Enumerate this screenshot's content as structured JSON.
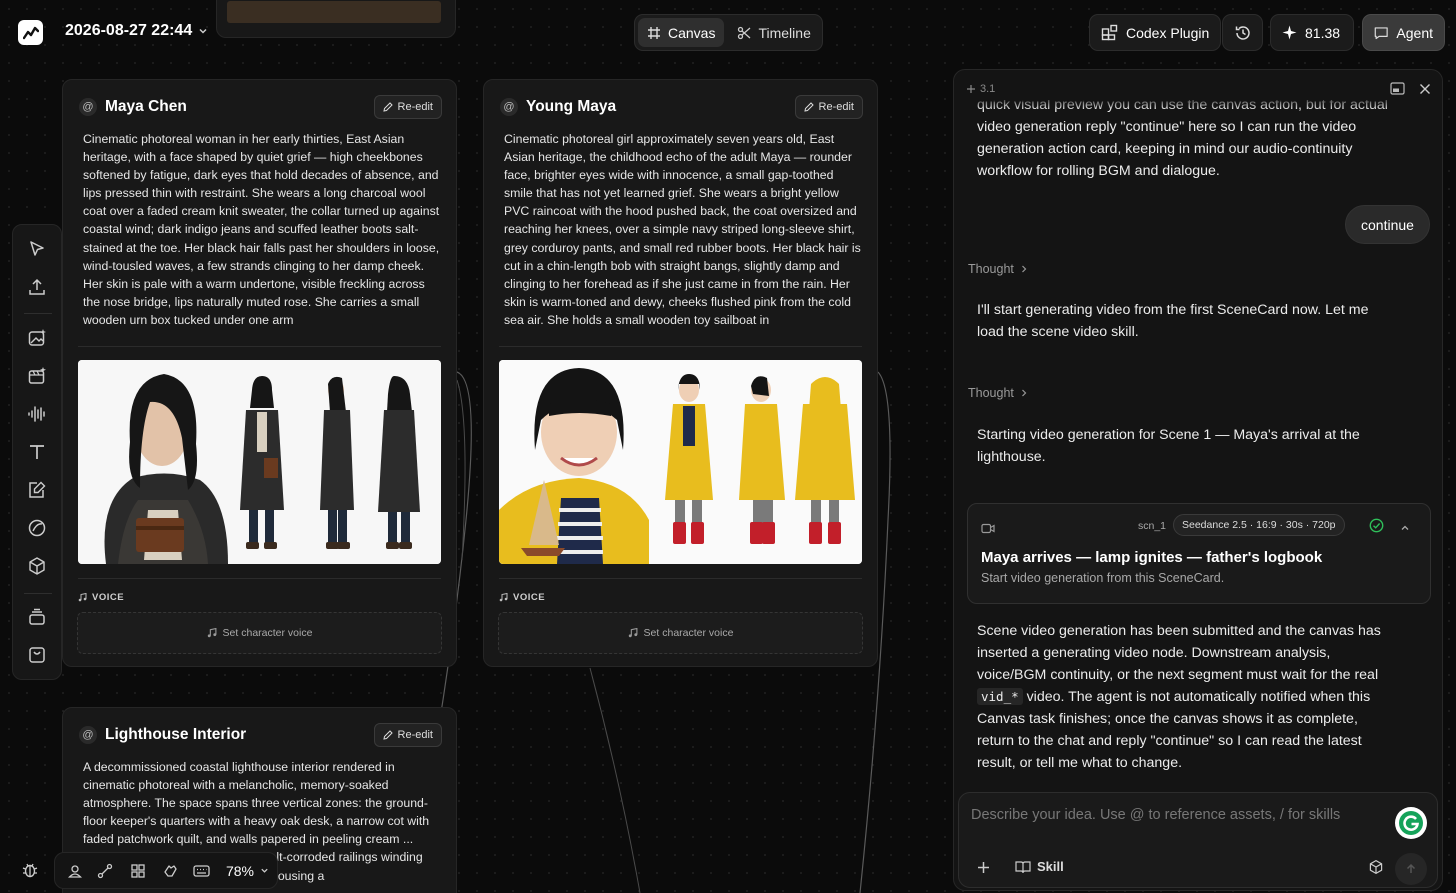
{
  "header": {
    "datetime": "2026-08-27 22:44",
    "tabs": [
      {
        "label": "Canvas",
        "active": true
      },
      {
        "label": "Timeline",
        "active": false
      }
    ],
    "codex_label": "Codex Plugin",
    "credits": "81.38",
    "agent_label": "Agent"
  },
  "cards": [
    {
      "title": "Maya Chen",
      "reedit_label": "Re-edit",
      "description": "Cinematic photoreal woman in her early thirties, East Asian heritage, with a face shaped by quiet grief — high cheekbones softened by fatigue, dark eyes that hold decades of absence, and lips pressed thin with restraint. She wears a long charcoal wool coat over a faded cream knit sweater, the collar turned up against coastal wind; dark indigo jeans and scuffed leather boots salt-stained at the toe. Her black hair falls past her shoulders in loose, wind-tousled waves, a few strands clinging to her damp cheek. Her skin is pale with a warm undertone, visible freckling across the nose bridge, lips naturally muted rose. She carries a small wooden urn box tucked under one arm",
      "voice_label": "VOICE",
      "voice_button": "Set character voice"
    },
    {
      "title": "Young Maya",
      "reedit_label": "Re-edit",
      "description": "Cinematic photoreal girl approximately seven years old, East Asian heritage, the childhood echo of the adult Maya — rounder face, brighter eyes wide with innocence, a small gap-toothed smile that has not yet learned grief. She wears a bright yellow PVC raincoat with the hood pushed back, the coat oversized and reaching her knees, over a simple navy striped long-sleeve shirt, grey corduroy pants, and small red rubber boots. Her black hair is cut in a chin-length bob with straight bangs, slightly damp and clinging to her forehead as if she just came in from the rain. Her skin is warm-toned and dewy, cheeks flushed pink from the cold sea air. She holds a small wooden toy sailboat in",
      "voice_label": "VOICE",
      "voice_button": "Set character voice"
    },
    {
      "title": "Lighthouse Interior",
      "reedit_label": "Re-edit",
      "description": "A decommissioned coastal lighthouse interior rendered in cinematic photoreal with a melancholic, memory-soaked atmosphere. The space spans three vertical zones: the ground-floor keeper's quarters with a heavy oak desk, a narrow cot with faded patchwork quilt, and walls papered in peeling cream ... drawings pinned with ... ase with salt-corroded railings winding upward; and the upper lamp room housing a"
    }
  ],
  "agent": {
    "version": "3.1",
    "messages": [
      {
        "role": "agent",
        "text": "quick visual preview you can use the canvas action, but for actual video generation reply \"continue\" here so I can run the video generation action card, keeping in mind our audio-continuity workflow for rolling BGM and dialogue."
      },
      {
        "role": "user",
        "text": "continue"
      },
      {
        "role": "thought",
        "text": "Thought"
      },
      {
        "role": "agent",
        "text": "I'll start generating video from the first SceneCard now. Let me load the scene video skill."
      },
      {
        "role": "thought",
        "text": "Thought"
      },
      {
        "role": "agent",
        "text": "Starting video generation for Scene 1 — Maya's arrival at the lighthouse."
      }
    ],
    "scene_card": {
      "id": "scn_1",
      "model": "Seedance 2.5 · 16:9 · 30s · 720p",
      "title": "Maya arrives — lamp ignites — father's logbook",
      "subtitle": "Start video generation from this SceneCard."
    },
    "final_message": {
      "part1": "Scene video generation has been submitted and the canvas has inserted a generating video node. Downstream analysis, voice/BGM continuity, or the next segment must wait for the real ",
      "code": "vid_*",
      "part2": " video. The agent is not automatically notified when this Canvas task finishes; once the canvas shows it as complete, return to the chat and reply \"continue\" so I can read the latest result, or tell me what to change."
    },
    "composer": {
      "placeholder": "Describe your idea. Use @ to reference assets, / for skills",
      "skill_label": "Skill"
    }
  },
  "bottombar": {
    "zoom": "78%"
  },
  "colors": {
    "panel": "#141414",
    "card": "#181818",
    "raincoat": "#e8bd1e",
    "coat": "#2b2b2b",
    "accent_green": "#2fbf5a"
  }
}
